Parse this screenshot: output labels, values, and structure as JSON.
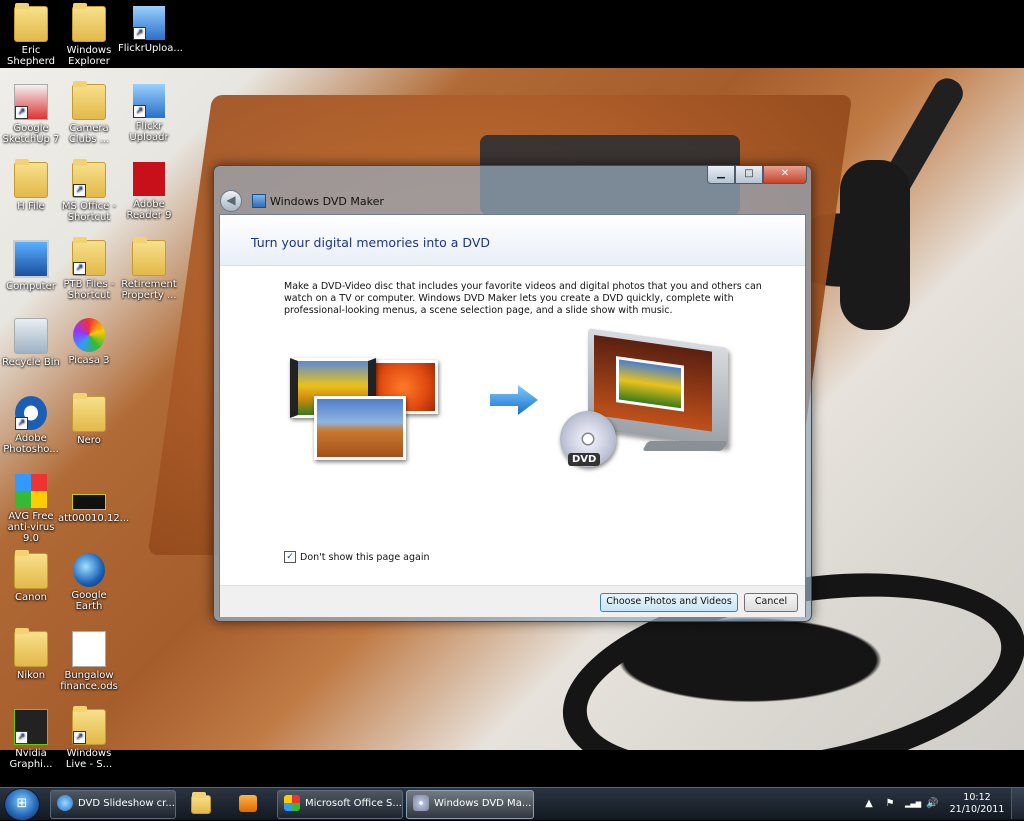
{
  "desktop": {
    "icons": [
      {
        "label": "Eric Shepherd",
        "icon": "user-folder-icon"
      },
      {
        "label": "Windows Explorer",
        "icon": "windows-explorer-icon"
      },
      {
        "label": "FlickrUploa...",
        "icon": "flickr-uploadr-icon"
      },
      {
        "label": "Google SketchUp 7",
        "icon": "google-sketchup-icon"
      },
      {
        "label": "Camera Clubs ...",
        "icon": "folder-icon"
      },
      {
        "label": "Flickr Uploadr",
        "icon": "flickr-uploadr-icon"
      },
      {
        "label": "H File",
        "icon": "folder-icon"
      },
      {
        "label": "MS Office - Shortcut",
        "icon": "folder-shortcut-icon"
      },
      {
        "label": "Adobe Reader 9",
        "icon": "adobe-reader-icon"
      },
      {
        "label": "Computer",
        "icon": "computer-icon"
      },
      {
        "label": "PTB Files - Shortcut",
        "icon": "folder-shortcut-icon"
      },
      {
        "label": "Retirement Property ...",
        "icon": "folder-icon"
      },
      {
        "label": "Recycle Bin",
        "icon": "recycle-bin-icon"
      },
      {
        "label": "Picasa 3",
        "icon": "picasa-icon"
      },
      {
        "label": "Adobe Photosho...",
        "icon": "adobe-photoshop-icon"
      },
      {
        "label": "Nero",
        "icon": "nero-icon"
      },
      {
        "label": "AVG Free anti-virus 9.0",
        "icon": "avg-antivirus-icon"
      },
      {
        "label": "att00010.12...",
        "icon": "image-file-icon"
      },
      {
        "label": "Canon",
        "icon": "folder-icon"
      },
      {
        "label": "Google Earth",
        "icon": "google-earth-icon"
      },
      {
        "label": "Nikon",
        "icon": "folder-icon"
      },
      {
        "label": "Bungalow finance.ods",
        "icon": "spreadsheet-file-icon"
      },
      {
        "label": "Nvidia Graphi...",
        "icon": "nvidia-icon"
      },
      {
        "label": "Windows Live - S...",
        "icon": "folder-shortcut-icon"
      }
    ]
  },
  "window": {
    "title": "Windows DVD Maker",
    "caption": {
      "minimize": "▁",
      "maximize": "□",
      "close": "✕"
    },
    "back_glyph": "◀",
    "page_title": "Turn your digital memories into a DVD",
    "intro": "Make a DVD-Video disc that includes your favorite videos and digital photos that you and others can watch on a TV or computer. Windows DVD Maker lets you create a DVD quickly, complete with professional-looking menus, a scene selection page, and a slide show with music.",
    "dvd_label": "DVD",
    "dont_show_label": "Don't show this page again",
    "dont_show_checked": true,
    "check_glyph": "✓",
    "buttons": {
      "choose": "Choose Photos and Videos",
      "cancel": "Cancel"
    }
  },
  "taskbar": {
    "start_glyph": "⊞",
    "tasks": [
      {
        "label": "DVD Slideshow cr...",
        "icon": "internet-explorer-icon",
        "active": false
      },
      {
        "label": "Microsoft Office S...",
        "icon": "ms-office-icon",
        "active": false
      },
      {
        "label": "Windows DVD Ma...",
        "icon": "windows-dvd-maker-icon",
        "active": true
      }
    ],
    "pinned": [
      {
        "icon": "windows-explorer-icon"
      },
      {
        "icon": "media-player-icon"
      }
    ],
    "tray": {
      "up_arrow": "▲",
      "flag": "⚑",
      "signal": "▂▄▆",
      "volume": "🔊"
    },
    "time": "10:12",
    "date": "21/10/2011"
  },
  "colors": {
    "title_blue": "#1e3287",
    "accent": "#3c7fb1"
  }
}
